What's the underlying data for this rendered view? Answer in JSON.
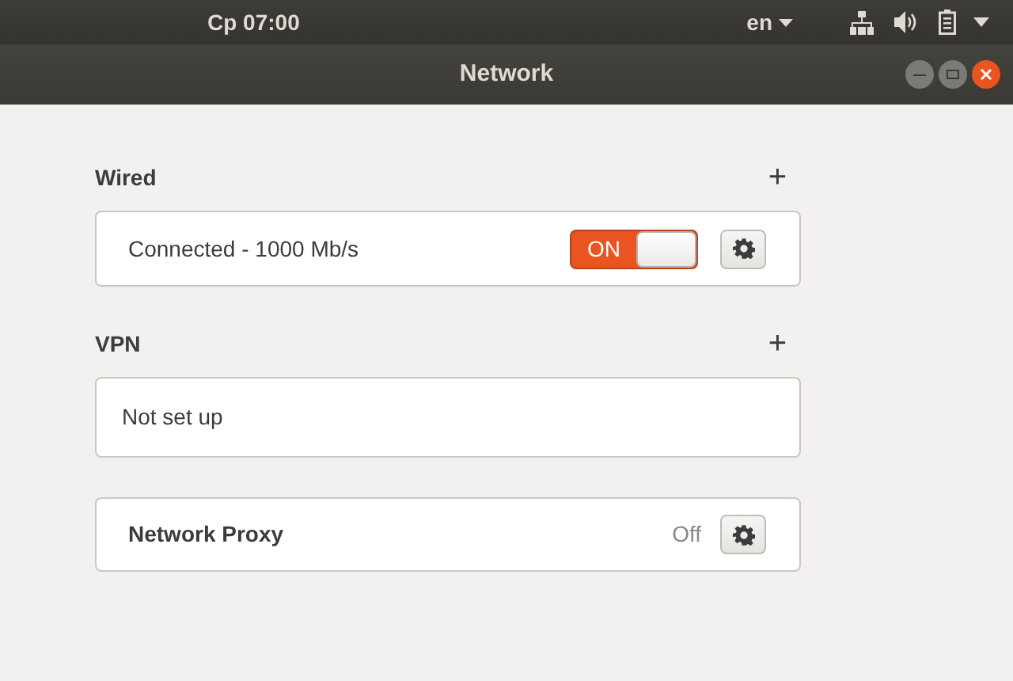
{
  "top_bar": {
    "clock": "Cp 07:00",
    "language": "en"
  },
  "window": {
    "title": "Network"
  },
  "wired": {
    "heading": "Wired",
    "add": "+",
    "status": "Connected - 1000 Mb/s",
    "switch": {
      "label": "ON",
      "on": true
    }
  },
  "vpn": {
    "heading": "VPN",
    "add": "+",
    "status": "Not set up"
  },
  "proxy": {
    "label": "Network Proxy",
    "status": "Off"
  }
}
